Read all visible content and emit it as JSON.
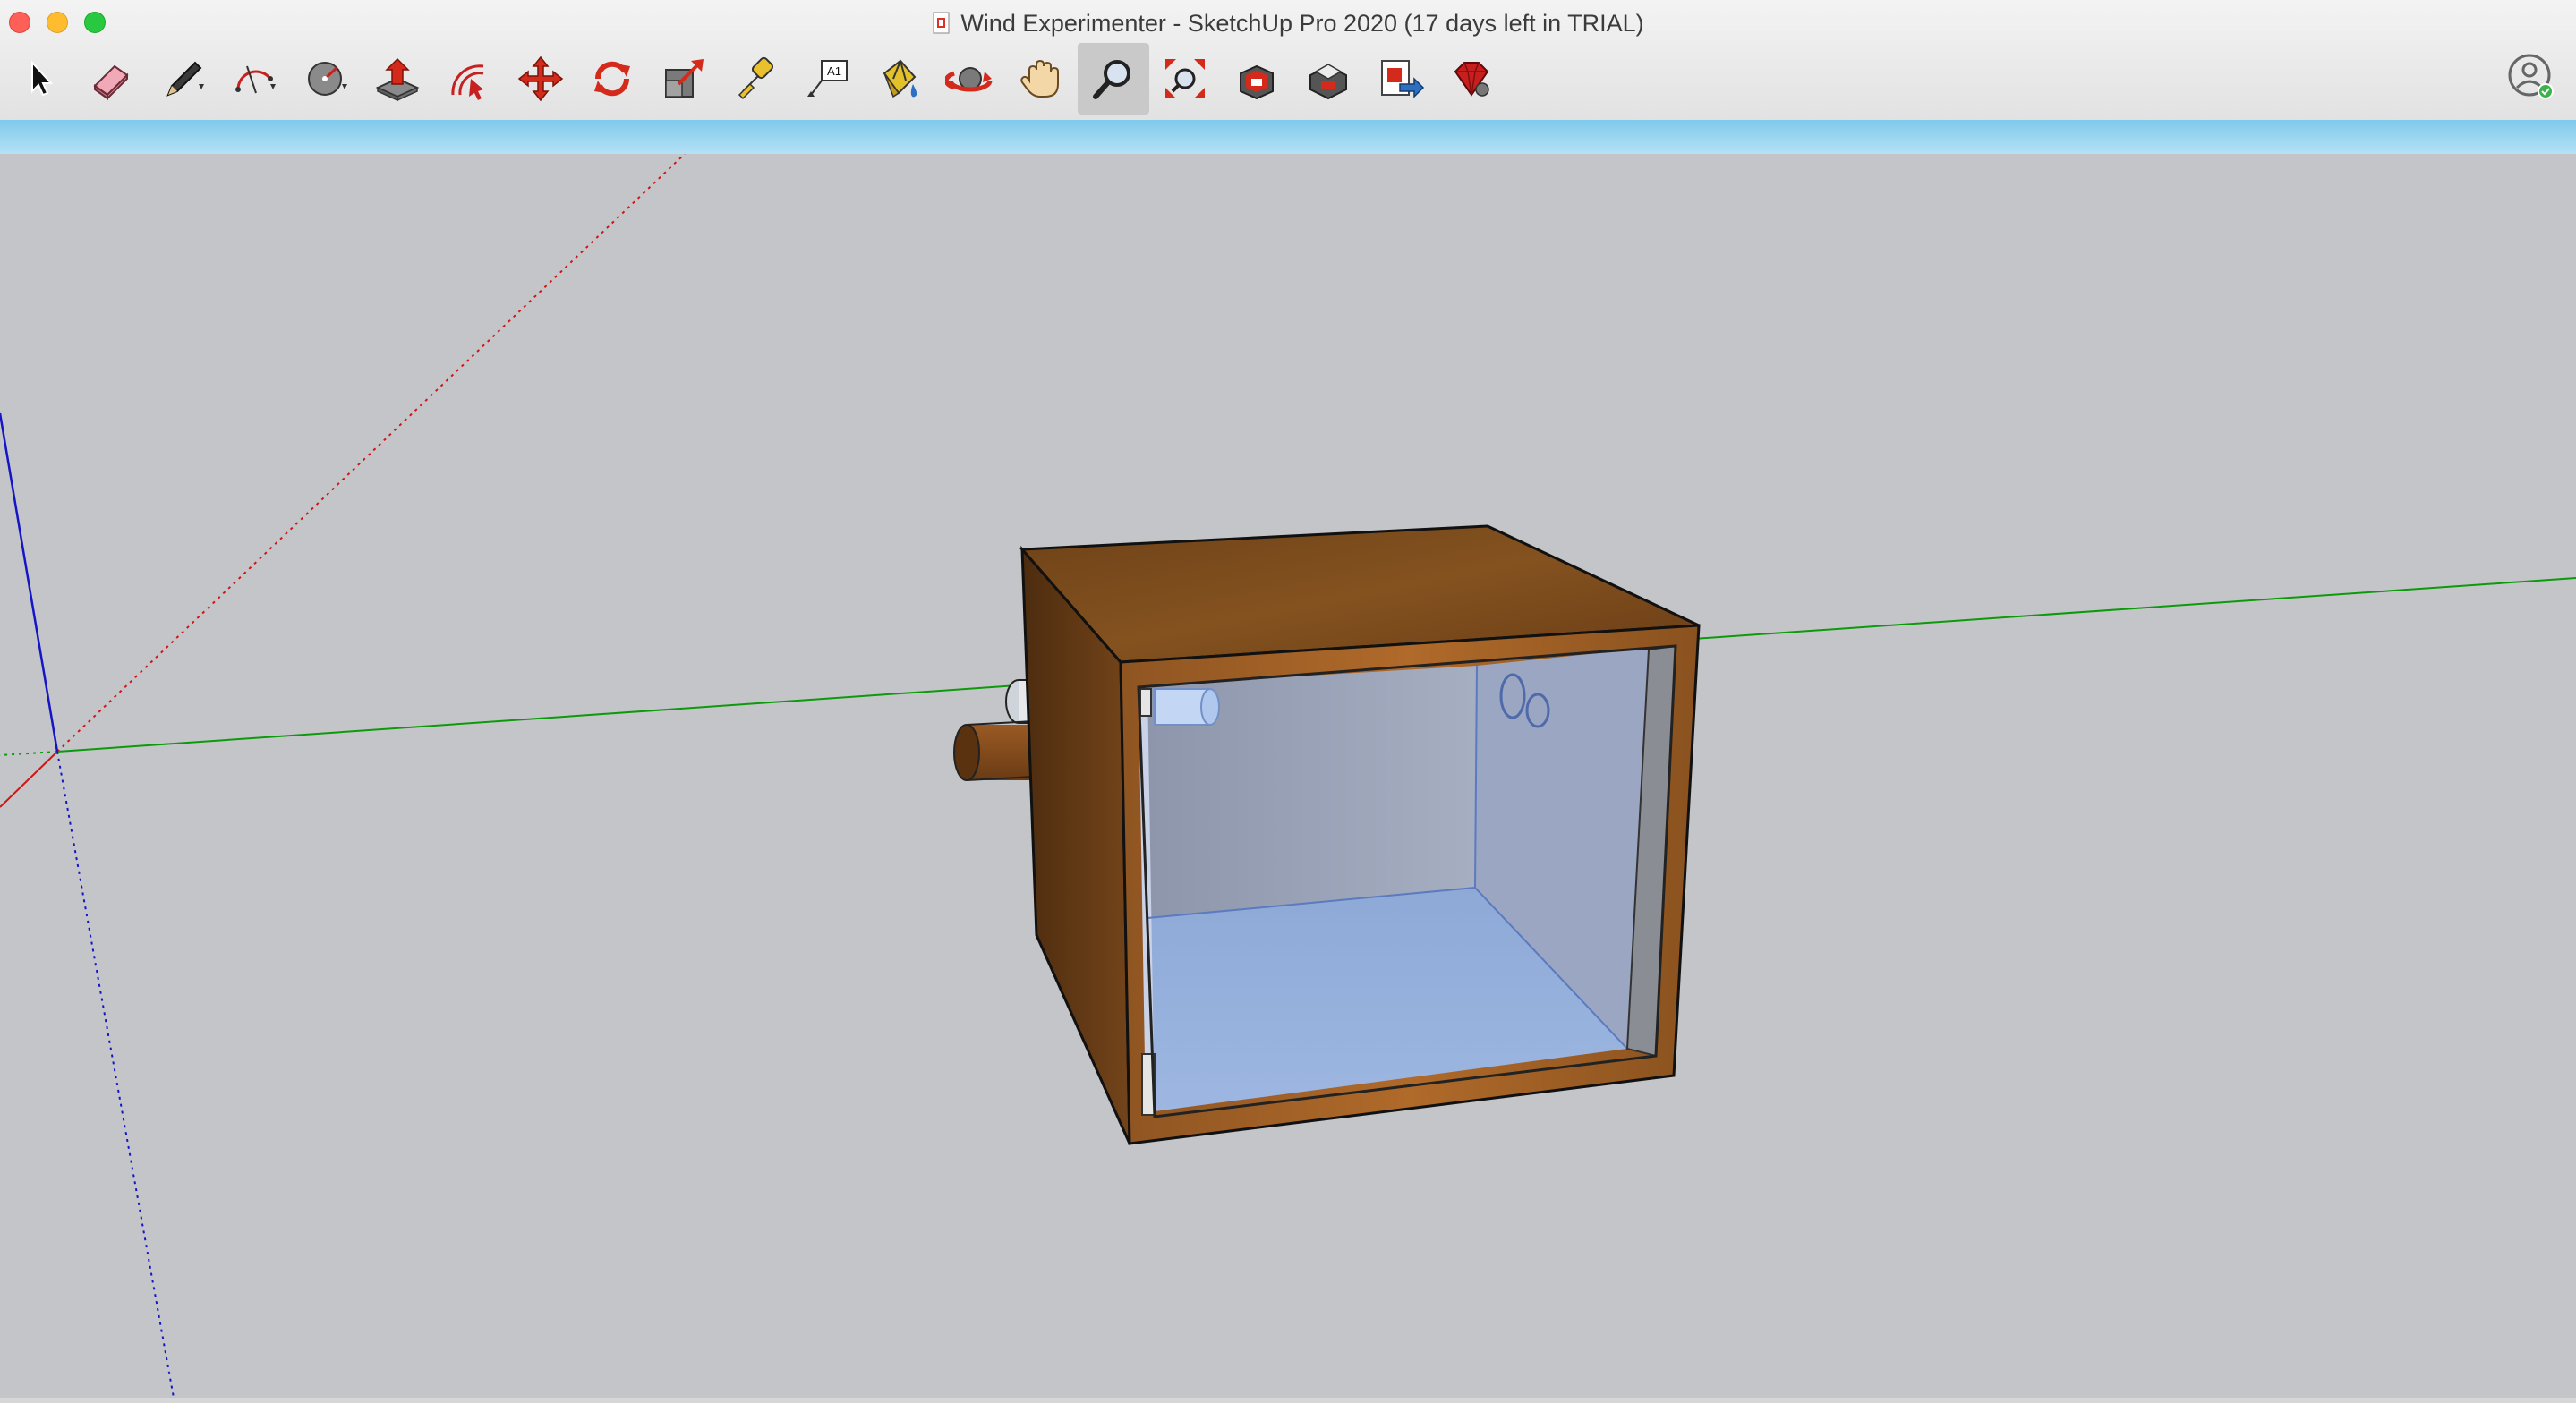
{
  "window": {
    "title": "Wind Experimenter - SketchUp Pro 2020 (17 days left in TRIAL)"
  },
  "toolbar": {
    "tools": [
      {
        "name": "select-tool",
        "icon": "arrow-cursor-icon"
      },
      {
        "name": "eraser-tool",
        "icon": "eraser-icon"
      },
      {
        "name": "line-tool",
        "icon": "pencil-icon"
      },
      {
        "name": "arc-tool",
        "icon": "arc-icon"
      },
      {
        "name": "shapes-tool",
        "icon": "circle-icon"
      },
      {
        "name": "push-pull-tool",
        "icon": "push-pull-icon"
      },
      {
        "name": "offset-tool",
        "icon": "offset-icon"
      },
      {
        "name": "move-tool",
        "icon": "move-arrows-icon"
      },
      {
        "name": "rotate-tool",
        "icon": "rotate-icon"
      },
      {
        "name": "scale-tool",
        "icon": "scale-icon"
      },
      {
        "name": "tape-measure-tool",
        "icon": "tape-measure-icon"
      },
      {
        "name": "text-tool",
        "icon": "text-label-icon",
        "label": "A1"
      },
      {
        "name": "paint-bucket-tool",
        "icon": "paint-bucket-icon"
      },
      {
        "name": "orbit-tool",
        "icon": "orbit-icon"
      },
      {
        "name": "pan-tool",
        "icon": "hand-icon"
      },
      {
        "name": "zoom-tool",
        "icon": "magnifier-icon",
        "active": true
      },
      {
        "name": "zoom-extents-tool",
        "icon": "zoom-extents-icon"
      },
      {
        "name": "3d-warehouse-button",
        "icon": "warehouse-icon"
      },
      {
        "name": "extension-warehouse-button",
        "icon": "extension-warehouse-icon"
      },
      {
        "name": "send-to-layout-button",
        "icon": "layout-export-icon"
      },
      {
        "name": "extension-manager-button",
        "icon": "ruby-gem-icon"
      }
    ],
    "profile_icon": "user-profile-icon"
  },
  "colors": {
    "viewport_bg": "#c4c5c8",
    "hint_bar": "#8fd0ef",
    "axis_red": "#d11515",
    "axis_green": "#0c9a0c",
    "axis_blue": "#1515c8",
    "wood": "#7a4a1f",
    "glass": "#a7bfe6"
  }
}
